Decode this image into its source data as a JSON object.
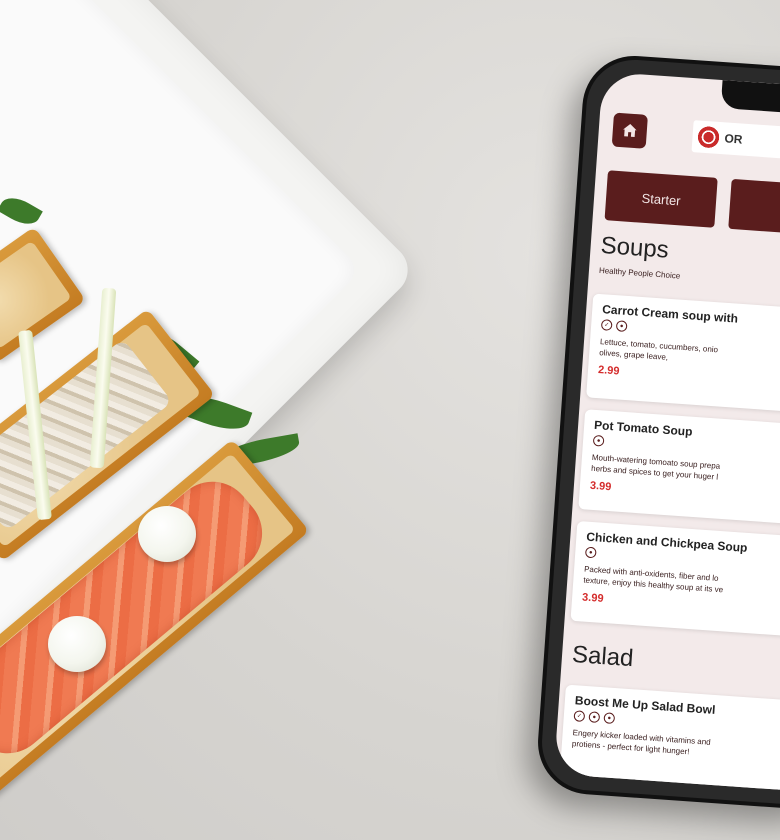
{
  "app": {
    "logo_text": "OR",
    "tabs": [
      "Starter",
      ""
    ]
  },
  "sections": [
    {
      "title": "Soups",
      "subtitle": "Healthy People Choice",
      "items": [
        {
          "name": "Carrot Cream soup with",
          "icons": [
            "leaf-icon",
            "allergen-icon"
          ],
          "desc1": "Lettuce, tomato, cucumbers, onio",
          "desc2": "olives, grape leave,",
          "price": "2.99"
        },
        {
          "name": "Pot Tomato Soup",
          "icons": [
            "allergen-icon"
          ],
          "desc1": "Mouth-watering tomoato soup prepa",
          "desc2": "herbs and spices to get your huger l",
          "price": "3.99"
        },
        {
          "name": "Chicken and Chickpea Soup",
          "icons": [
            "allergen-icon"
          ],
          "desc1": "Packed with anti-oxidents, fiber and lo",
          "desc2": "texture, enjoy this healthy soup at its ve",
          "price": "3.99"
        }
      ]
    },
    {
      "title": "Salad",
      "items": [
        {
          "name": "Boost Me Up Salad Bowl",
          "icons": [
            "leaf-icon",
            "allergen-icon",
            "allergen-icon"
          ],
          "desc1": "Engery kicker loaded with vitamins and",
          "desc2": "protiens - perfect for light hunger!"
        }
      ]
    }
  ],
  "colors": {
    "brand": "#5a1d1d",
    "price": "#d42c2c",
    "screen_bg": "#f3eaea"
  }
}
